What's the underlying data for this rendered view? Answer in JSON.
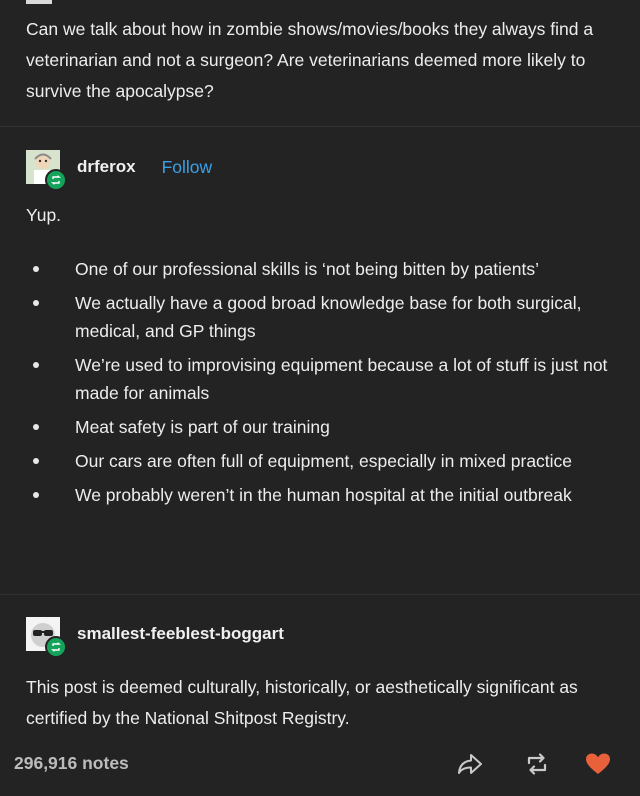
{
  "original_post": {
    "text": "Can we talk about how in zombie shows/movies/books they always find a veterinarian and not a surgeon? Are veterinarians deemed more likely to survive the apocalypse?"
  },
  "reblog1": {
    "username": "drferox",
    "follow_label": "Follow",
    "intro": "Yup.",
    "bullets": [
      "One of our professional skills is ‘not being bitten by patients’",
      "We actually have a good broad knowledge base for both surgical, medical, and GP things",
      "We’re used to improvising equipment because a lot of stuff is just not made for animals",
      "Meat safety is part of our training",
      "Our cars are often full of equipment, especially in mixed practice",
      "We probably weren’t in the human hospital at the initial outbreak"
    ]
  },
  "reblog2": {
    "username": "smallest-feeblest-boggart",
    "text": "This post is deemed culturally, historically, or aesthetically significant as certified by the National Shitpost Registry."
  },
  "footer": {
    "notes": "296,916 notes",
    "icons": [
      "share-icon",
      "reblog-icon",
      "like-heart-icon"
    ]
  },
  "colors": {
    "background": "#232323",
    "follow": "#3aa0e8",
    "reblog_badge": "#15a35c",
    "heart": "#e8613b"
  }
}
